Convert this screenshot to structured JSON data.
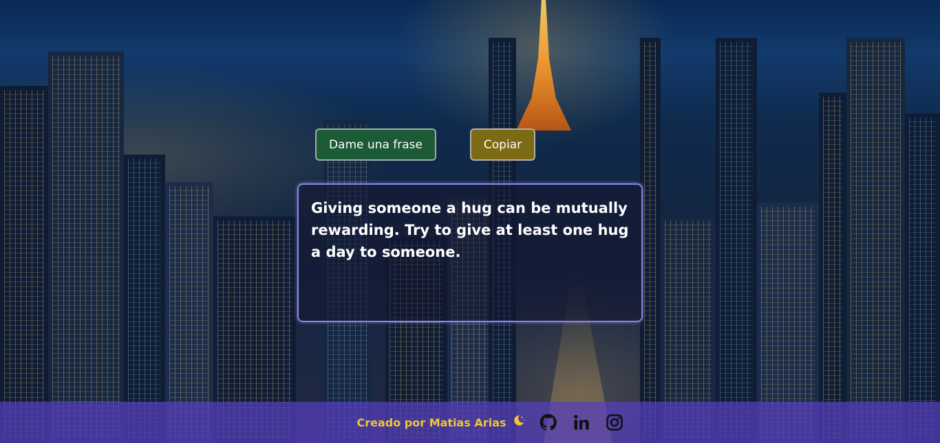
{
  "controls": {
    "new_quote_label": "Dame una frase",
    "copy_label": "Copiar"
  },
  "quote": {
    "text": "Giving someone a hug can be mutually rewarding. Try to give at least one hug a day to someone."
  },
  "footer": {
    "credit_text": "Creado por Matias Arias",
    "credit_icon": "moon-stars-icon",
    "social": [
      {
        "name": "github-icon"
      },
      {
        "name": "linkedin-icon"
      },
      {
        "name": "instagram-icon"
      }
    ]
  },
  "colors": {
    "new_quote_button": "#1d5a36",
    "copy_button": "#7d6a14",
    "credit_text": "#f2c531",
    "footer_bar": "#563ebe",
    "card_border": "#8a86e6"
  }
}
